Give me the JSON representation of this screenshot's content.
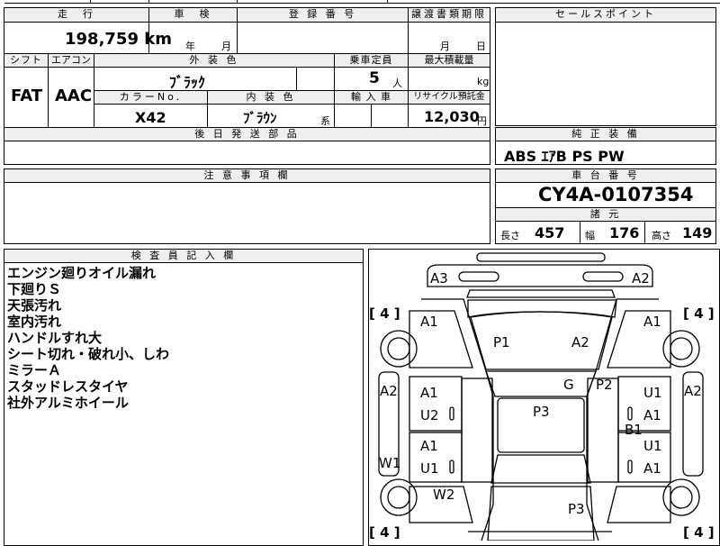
{
  "header": {
    "mileage_label": "走　行",
    "inspection_label": "車　検",
    "registration_label": "登 録 番 号",
    "transfer_docs_label": "譲渡書類期限",
    "sales_point_label": "セールスポイント"
  },
  "mileage": {
    "value": "198,759",
    "unit": "km"
  },
  "inspection": {
    "year_unit": "年",
    "month_unit": "月"
  },
  "transfer_docs": {
    "month_unit": "月",
    "day_unit": "日"
  },
  "row2": {
    "shift_label": "シフト",
    "aircon_label": "エアコン",
    "exterior_color_label": "外 装 色",
    "capacity_label": "乗車定員",
    "max_load_label": "最大積載量",
    "shift_value": "FAT",
    "aircon_value": "AAC",
    "exterior_color_value": "ﾌﾞﾗｯｸ",
    "capacity_value": "5",
    "capacity_unit": "人",
    "max_load_unit": "kg",
    "color_no_label": "カラーNo.",
    "interior_color_label": "内 装 色",
    "import_label": "輸 入 車",
    "recycle_label": "リサイクル預託金",
    "color_no_value": "X42",
    "interior_color_value": "ﾌﾞﾗｳﾝ",
    "interior_color_suffix": "系",
    "recycle_value": "12,030",
    "recycle_unit": "円"
  },
  "later_parts_label": "後 日 発 送 部 品",
  "standard_equipment": {
    "label": "純 正 装 備",
    "value": "ABS ｴｱB PS PW"
  },
  "notes_label": "注 意 事 項 欄",
  "chassis": {
    "label": "車 台 番 号",
    "value": "CY4A-0107354"
  },
  "specs": {
    "label": "諸 元",
    "length_label": "長さ",
    "length_value": "457",
    "width_label": "幅",
    "width_value": "176",
    "height_label": "高さ",
    "height_value": "149"
  },
  "inspector": {
    "label": "検 査 員 記 入 欄",
    "notes": [
      "エンジン廻りオイル漏れ",
      "下廻りＳ",
      "天張汚れ",
      "室内汚れ",
      "ハンドルすれ大",
      "シート切れ・破れ小、しわ",
      "ミラーＡ",
      "スタッドレスタイヤ",
      "社外アルミホイール"
    ]
  },
  "diagram": {
    "marks": {
      "front_left": "A3",
      "front_right": "A2",
      "left_front_fender": "A1",
      "right_front_fender": "A1",
      "hood_left": "P1",
      "hood_right": "A2",
      "windshield": "G",
      "right_pillar": "P2",
      "left_side": "A2",
      "right_side": "A2",
      "left_front_door_a": "A1",
      "left_front_door_b": "U2",
      "right_front_door_a": "U1",
      "right_front_door_b": "A1",
      "roof": "P3",
      "right_sill": "B1",
      "left_rear_door_a": "A1",
      "left_rear_door_b": "U1",
      "right_rear_door_a": "U1",
      "right_rear_door_b": "A1",
      "left_rocker": "W1",
      "left_rear_fender": "W2",
      "trunk": "P3"
    },
    "tires": {
      "front_left": "4",
      "front_right": "4",
      "rear_left": "4",
      "rear_right": "4"
    }
  }
}
